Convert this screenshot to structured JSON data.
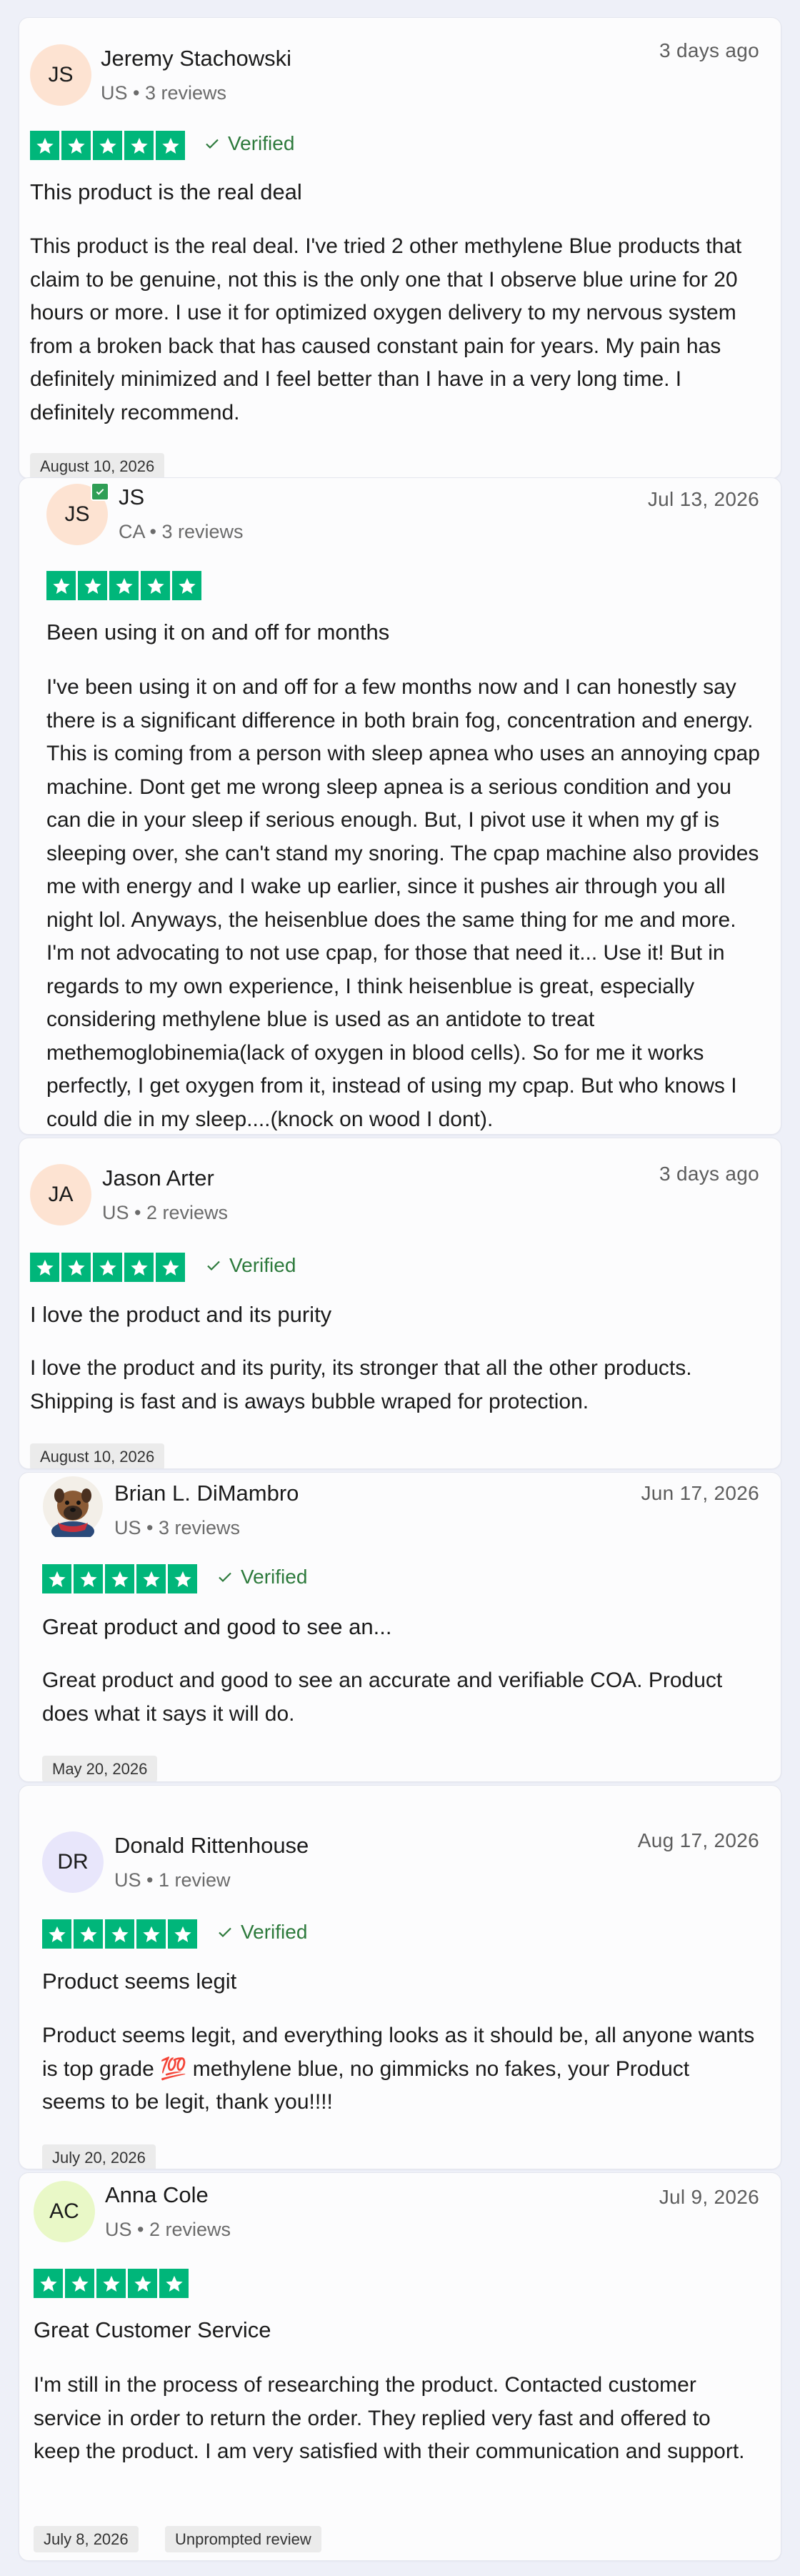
{
  "reviews": [
    {
      "initials": "JS",
      "name": "Jeremy Stachowski",
      "meta": "US • 3 reviews",
      "date": "3 days ago",
      "rating": 5,
      "verified": "Verified",
      "title": "This product is the real deal",
      "body": "This product is the real deal. I've tried 2 other methylene Blue products that claim to be genuine, not this is the only one that I observe blue urine for 20 hours or more. I use it for optimized oxygen delivery to my nervous system from a broken back that has caused constant pain for years. My pain has definitely minimized and I feel better than I have in a very long time. I definitely recommend.",
      "experience_date": "August 10, 2026"
    },
    {
      "initials": "JS",
      "name": "JS",
      "meta": "CA • 3 reviews",
      "date": "Jul 13, 2026",
      "rating": 5,
      "title": "Been using it on and off for months",
      "body": "I've been using it on and off for a few months now and I can honestly say there is a significant difference in both brain fog, concentration and energy. This is coming from a person with sleep apnea who uses an annoying cpap machine. Dont get me wrong sleep apnea is a serious condition and you can die in your sleep if serious enough. But, I pivot use it when my gf is sleeping over, she can't stand my snoring. The cpap machine also provides me with energy and I wake up earlier, since it pushes air through you all night lol. Anyways, the heisenblue does the same thing for me and more. I'm not advocating to not use cpap, for those that need it... Use it! But in regards to my own experience, I think heisenblue is great, especially considering methylene blue is used as an antidote to treat methemoglobinemia(lack of oxygen in blood cells). So for me it works perfectly, I get oxygen from it, instead of using my cpap. But who knows I could die in my sleep....(knock on wood I dont)."
    },
    {
      "initials": "JA",
      "name": "Jason Arter",
      "meta": "US • 2 reviews",
      "date": "3 days ago",
      "rating": 5,
      "verified": "Verified",
      "title": "I love the product and its purity",
      "body": "I love the product and its purity, its stronger that all the other products. Shipping is fast and is aways bubble wraped for protection.",
      "experience_date": "August 10, 2026"
    },
    {
      "name": "Brian L. DiMambro",
      "meta": "US • 3 reviews",
      "date": "Jun 17, 2026",
      "rating": 5,
      "verified": "Verified",
      "title": "Great product and good to see an...",
      "body": "Great product and good to see an accurate and verifiable COA. Product does what it says it will do.",
      "experience_date": "May 20, 2026"
    },
    {
      "initials": "DR",
      "name": "Donald Rittenhouse",
      "meta": "US • 1 review",
      "date": "Aug 17, 2026",
      "rating": 5,
      "verified": "Verified",
      "title": "Product seems legit",
      "body": "Product seems legit, and everything looks as it should be, all anyone wants is top grade 💯 methylene blue, no gimmicks no fakes, your Product seems to be legit, thank you!!!!",
      "experience_date": "July 20, 2026"
    },
    {
      "initials": "AC",
      "name": "Anna Cole",
      "meta": "US • 2 reviews",
      "date": "Jul 9, 2026",
      "rating": 5,
      "title": "Great Customer Service",
      "body": "I'm still in the process of researching the product. Contacted customer service in order to return the order. They replied very fast and offered to keep the product. I am very satisfied with their communication and support.",
      "experience_date": "July 8, 2026",
      "tag": "Unprompted review"
    }
  ]
}
